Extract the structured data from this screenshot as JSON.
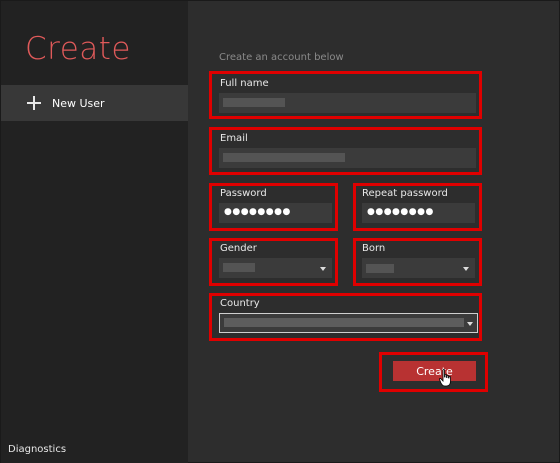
{
  "sidebar": {
    "title": "Create",
    "nav_item_label": "New User",
    "diagnostics_label": "Diagnostics"
  },
  "form": {
    "subtitle": "Create an account below",
    "full_name_label": "Full name",
    "email_label": "Email",
    "password_label": "Password",
    "password_value": "●●●●●●●●",
    "repeat_password_label": "Repeat password",
    "repeat_password_value": "●●●●●●●●",
    "gender_label": "Gender",
    "born_label": "Born",
    "country_label": "Country",
    "create_button_label": "Create"
  },
  "colors": {
    "accent": "#e05a5a",
    "button": "#b83232",
    "highlight": "#e00000"
  }
}
